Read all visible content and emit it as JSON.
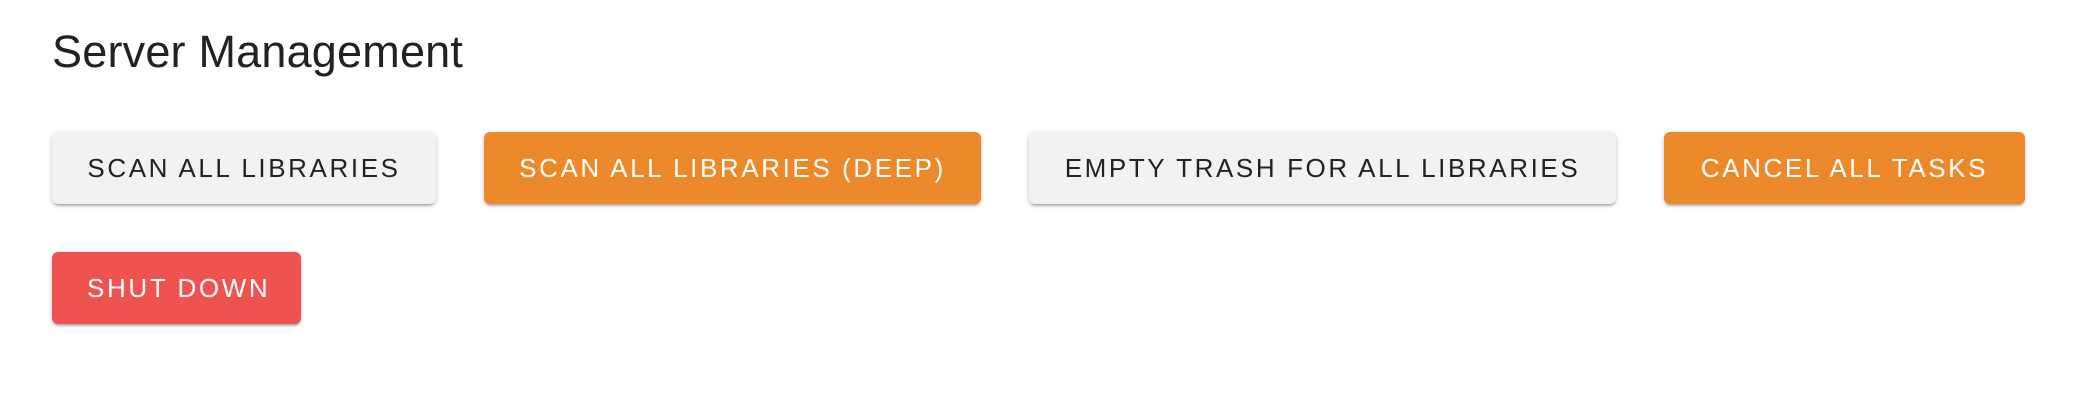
{
  "page": {
    "title": "Server Management"
  },
  "actions": {
    "scan_all": "SCAN ALL LIBRARIES",
    "scan_all_deep": "SCAN ALL LIBRARIES (DEEP)",
    "empty_trash": "EMPTY TRASH FOR ALL LIBRARIES",
    "cancel_all": "CANCEL ALL TASKS",
    "shut_down": "SHUT DOWN"
  },
  "colors": {
    "default_button": "#f2f2f2",
    "warning_button": "#ec8a2b",
    "danger_button": "#ef5350"
  }
}
